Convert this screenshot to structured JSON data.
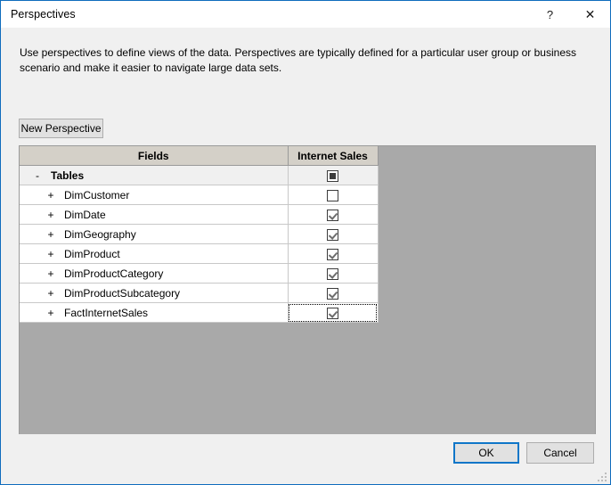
{
  "window": {
    "title": "Perspectives",
    "help_label": "?",
    "close_label": "✕"
  },
  "description": "Use perspectives to define views of the data. Perspectives are typically defined for a particular user group or business scenario and make it easier to navigate large data sets.",
  "toolbar": {
    "new_perspective_label": "New Perspective"
  },
  "grid": {
    "columns": [
      {
        "key": "fields",
        "label": "Fields"
      },
      {
        "key": "internet_sales",
        "label": "Internet Sales"
      }
    ],
    "rows": [
      {
        "toggle": "-",
        "label": "Tables",
        "indent": 0,
        "group": true,
        "state": "indeterminate",
        "focused": false
      },
      {
        "toggle": "+",
        "label": "DimCustomer",
        "indent": 1,
        "group": false,
        "state": "unchecked",
        "focused": false
      },
      {
        "toggle": "+",
        "label": "DimDate",
        "indent": 1,
        "group": false,
        "state": "checked",
        "focused": false
      },
      {
        "toggle": "+",
        "label": "DimGeography",
        "indent": 1,
        "group": false,
        "state": "checked",
        "focused": false
      },
      {
        "toggle": "+",
        "label": "DimProduct",
        "indent": 1,
        "group": false,
        "state": "checked",
        "focused": false
      },
      {
        "toggle": "+",
        "label": "DimProductCategory",
        "indent": 1,
        "group": false,
        "state": "checked",
        "focused": false
      },
      {
        "toggle": "+",
        "label": "DimProductSubcategory",
        "indent": 1,
        "group": false,
        "state": "checked",
        "focused": false
      },
      {
        "toggle": "+",
        "label": "FactInternetSales",
        "indent": 1,
        "group": false,
        "state": "checked",
        "focused": true
      }
    ]
  },
  "footer": {
    "ok_label": "OK",
    "cancel_label": "Cancel"
  },
  "colors": {
    "dialog_border": "#0f6cbd",
    "default_button_border": "#0f76c8",
    "grid_background": "#a9a9a9",
    "header_background": "#d4d0c8",
    "group_row_background": "#f0f0f0"
  }
}
